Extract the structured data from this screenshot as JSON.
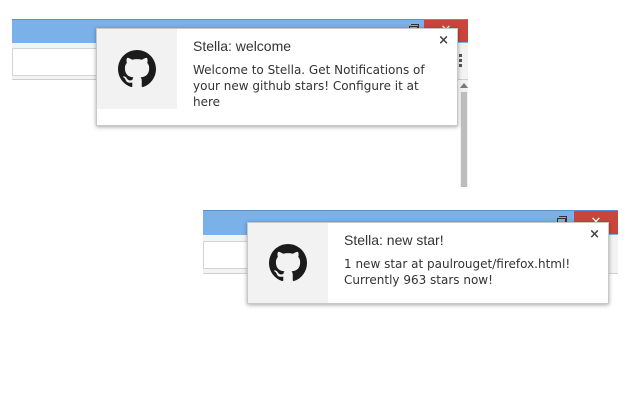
{
  "app_name": "Stella",
  "window_controls": {
    "close_glyph": "✕"
  },
  "notifications": [
    {
      "title": "Stella: welcome",
      "body": "Welcome to Stella. Get Notifications of your new github stars! Configure it at here",
      "icon": "github-octocat-icon",
      "close_glyph": "×"
    },
    {
      "title": "Stella: new star!",
      "body": "1 new star at paulrouget/firefox.html! Currently 963 stars now!",
      "icon": "github-octocat-icon",
      "close_glyph": "×"
    }
  ],
  "colors": {
    "titlebar": "#7ab1e8",
    "close_button": "#c9453b",
    "icon_background": "#f2f2f2",
    "text": "#333333"
  }
}
